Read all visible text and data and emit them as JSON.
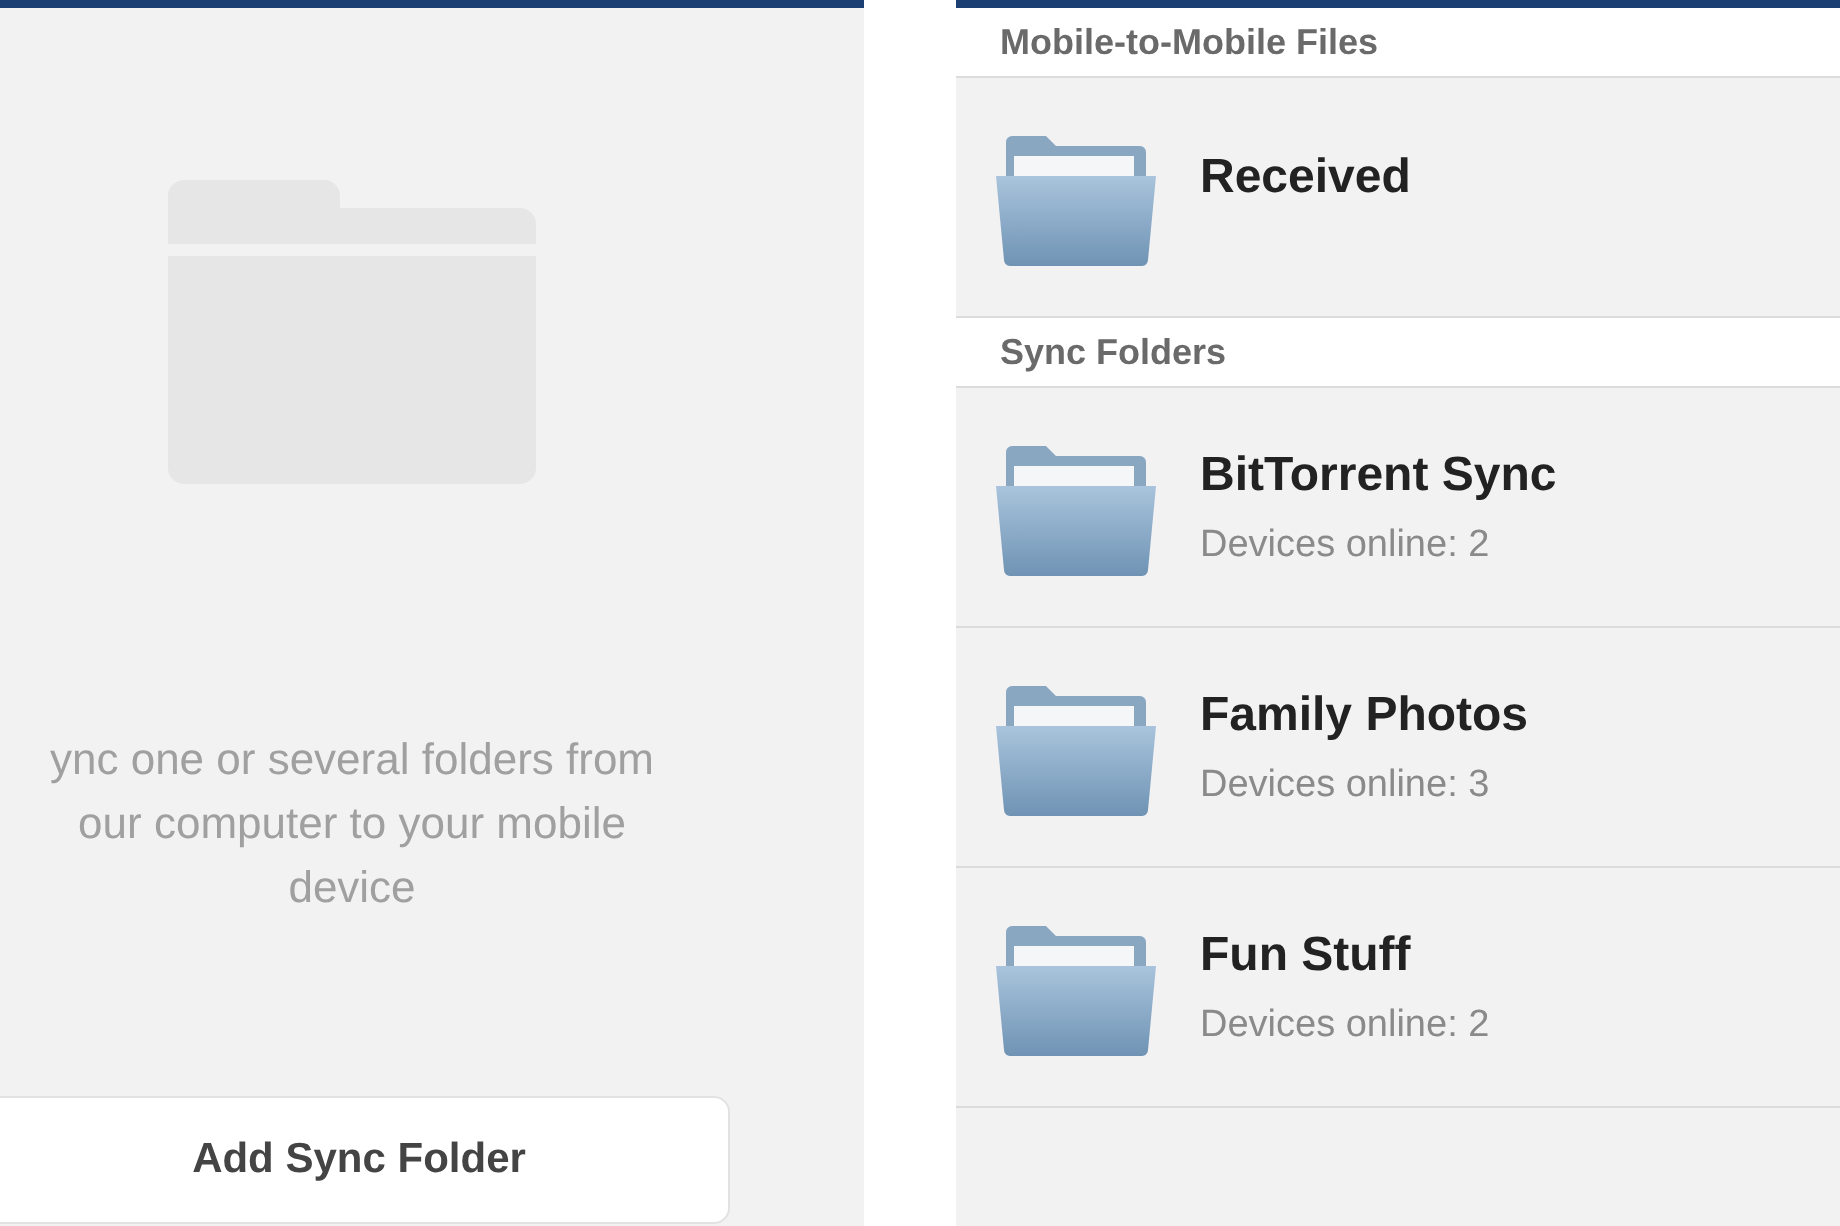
{
  "left_screen": {
    "message_lines": [
      "ync one or several folders from",
      "our computer to your mobile",
      "device"
    ],
    "button": "Add Sync Folder"
  },
  "right_screen": {
    "sections": [
      {
        "header": "Mobile-to-Mobile Files",
        "items": [
          {
            "name": "Received"
          }
        ]
      },
      {
        "header": "Sync Folders",
        "items": [
          {
            "name": "BitTorrent Sync",
            "status": "Devices online: 2"
          },
          {
            "name": "Family Photos",
            "status": "Devices online: 3"
          },
          {
            "name": "Fun Stuff",
            "status": "Devices online: 2"
          }
        ]
      }
    ]
  }
}
